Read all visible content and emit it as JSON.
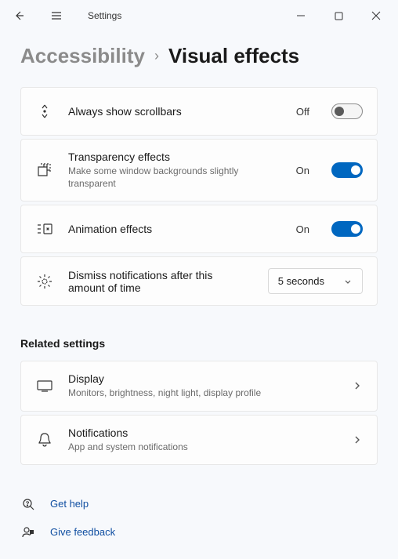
{
  "window": {
    "title": "Settings"
  },
  "breadcrumb": {
    "parent": "Accessibility",
    "current": "Visual effects"
  },
  "settings": {
    "scrollbars": {
      "label": "Always show scrollbars",
      "state": "Off"
    },
    "transparency": {
      "label": "Transparency effects",
      "desc": "Make some window backgrounds slightly transparent",
      "state": "On"
    },
    "animation": {
      "label": "Animation effects",
      "state": "On"
    },
    "dismiss": {
      "label": "Dismiss notifications after this amount of time",
      "value": "5 seconds"
    }
  },
  "related": {
    "heading": "Related settings",
    "display": {
      "title": "Display",
      "desc": "Monitors, brightness, night light, display profile"
    },
    "notifications": {
      "title": "Notifications",
      "desc": "App and system notifications"
    }
  },
  "help": {
    "gethelp": "Get help",
    "feedback": "Give feedback"
  }
}
